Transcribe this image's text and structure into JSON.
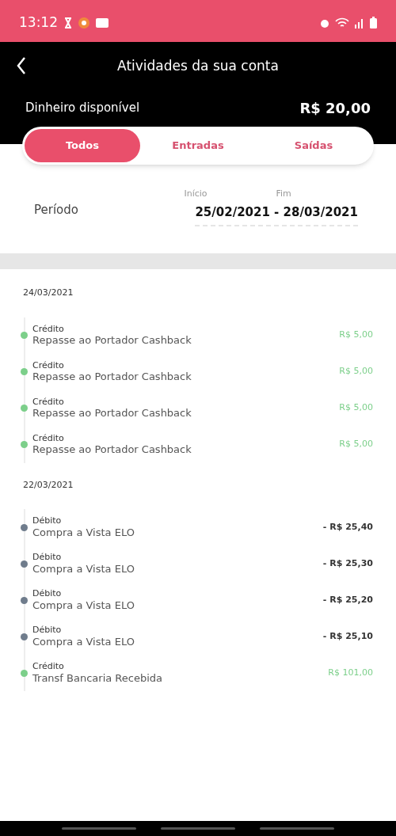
{
  "status_bar": {
    "time": "13:12"
  },
  "header": {
    "title": "Atividades da sua conta"
  },
  "balance": {
    "label": "Dinheiro disponível",
    "value": "R$ 20,00"
  },
  "tabs": [
    {
      "label": "Todos",
      "selected": true
    },
    {
      "label": "Entradas",
      "selected": false
    },
    {
      "label": "Saídas",
      "selected": false
    }
  ],
  "period": {
    "label": "Período",
    "start_label": "Início",
    "end_label": "Fim",
    "range": "25/02/2021 - 28/03/2021"
  },
  "groups": [
    {
      "date": "24/03/2021",
      "items": [
        {
          "kind": "credit",
          "type": "Crédito",
          "description": "Repasse ao Portador Cashback",
          "amount": "R$ 5,00"
        },
        {
          "kind": "credit",
          "type": "Crédito",
          "description": "Repasse ao Portador Cashback",
          "amount": "R$ 5,00"
        },
        {
          "kind": "credit",
          "type": "Crédito",
          "description": "Repasse ao Portador Cashback",
          "amount": "R$ 5,00"
        },
        {
          "kind": "credit",
          "type": "Crédito",
          "description": "Repasse ao Portador Cashback",
          "amount": "R$ 5,00"
        }
      ]
    },
    {
      "date": "22/03/2021",
      "items": [
        {
          "kind": "debit",
          "type": "Débito",
          "description": "Compra a Vista ELO",
          "amount": "- R$ 25,40"
        },
        {
          "kind": "debit",
          "type": "Débito",
          "description": "Compra a Vista ELO",
          "amount": "- R$ 25,30"
        },
        {
          "kind": "debit",
          "type": "Débito",
          "description": "Compra a Vista ELO",
          "amount": "- R$ 25,20"
        },
        {
          "kind": "debit",
          "type": "Débito",
          "description": "Compra a Vista ELO",
          "amount": "- R$ 25,10"
        },
        {
          "kind": "credit",
          "type": "Crédito",
          "description": "Transf Bancaria Recebida",
          "amount": "R$ 101,00"
        }
      ]
    }
  ]
}
